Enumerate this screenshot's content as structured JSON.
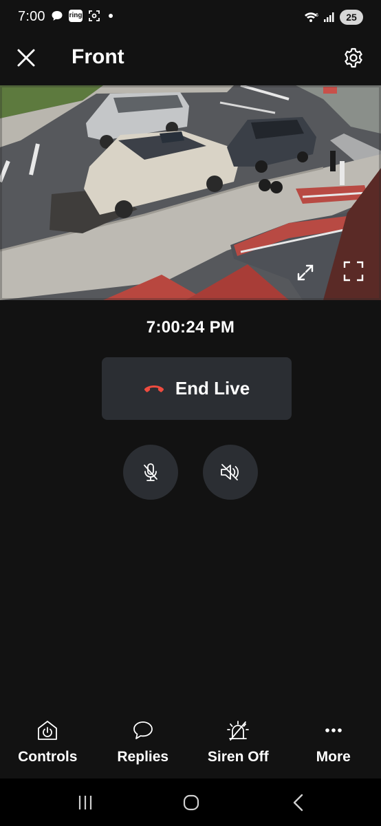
{
  "status_bar": {
    "time": "7:00",
    "ring_badge": "ring",
    "network": "6",
    "battery": "25",
    "icons": [
      "chat-bubble-icon",
      "ring-app-icon",
      "screenshot-icon",
      "notification-dot",
      "wifi-icon",
      "signal-icon",
      "battery-icon"
    ]
  },
  "header": {
    "title": "Front",
    "close_icon": "close-icon",
    "settings_icon": "gear-icon"
  },
  "camera": {
    "expand_icon": "expand-icon",
    "fullscreen_icon": "fullscreen-icon"
  },
  "timestamp": "7:00:24 PM",
  "end_live": {
    "label": "End Live",
    "icon": "hang-up-icon",
    "icon_color": "#ef4b3f"
  },
  "audio_controls": {
    "mic_icon": "mic-muted-icon",
    "speaker_icon": "speaker-muted-icon"
  },
  "actions": [
    {
      "label": "Controls",
      "icon": "power-icon"
    },
    {
      "label": "Replies",
      "icon": "chat-icon"
    },
    {
      "label": "Siren Off",
      "icon": "siren-off-icon"
    },
    {
      "label": "More",
      "icon": "more-dots-icon"
    }
  ],
  "nav_bar": {
    "icons": [
      "recents-icon",
      "home-icon",
      "back-icon"
    ]
  },
  "colors": {
    "background": "#121212",
    "surface": "#2b2e33",
    "accent_red": "#ef4b3f",
    "text": "#ffffff"
  }
}
